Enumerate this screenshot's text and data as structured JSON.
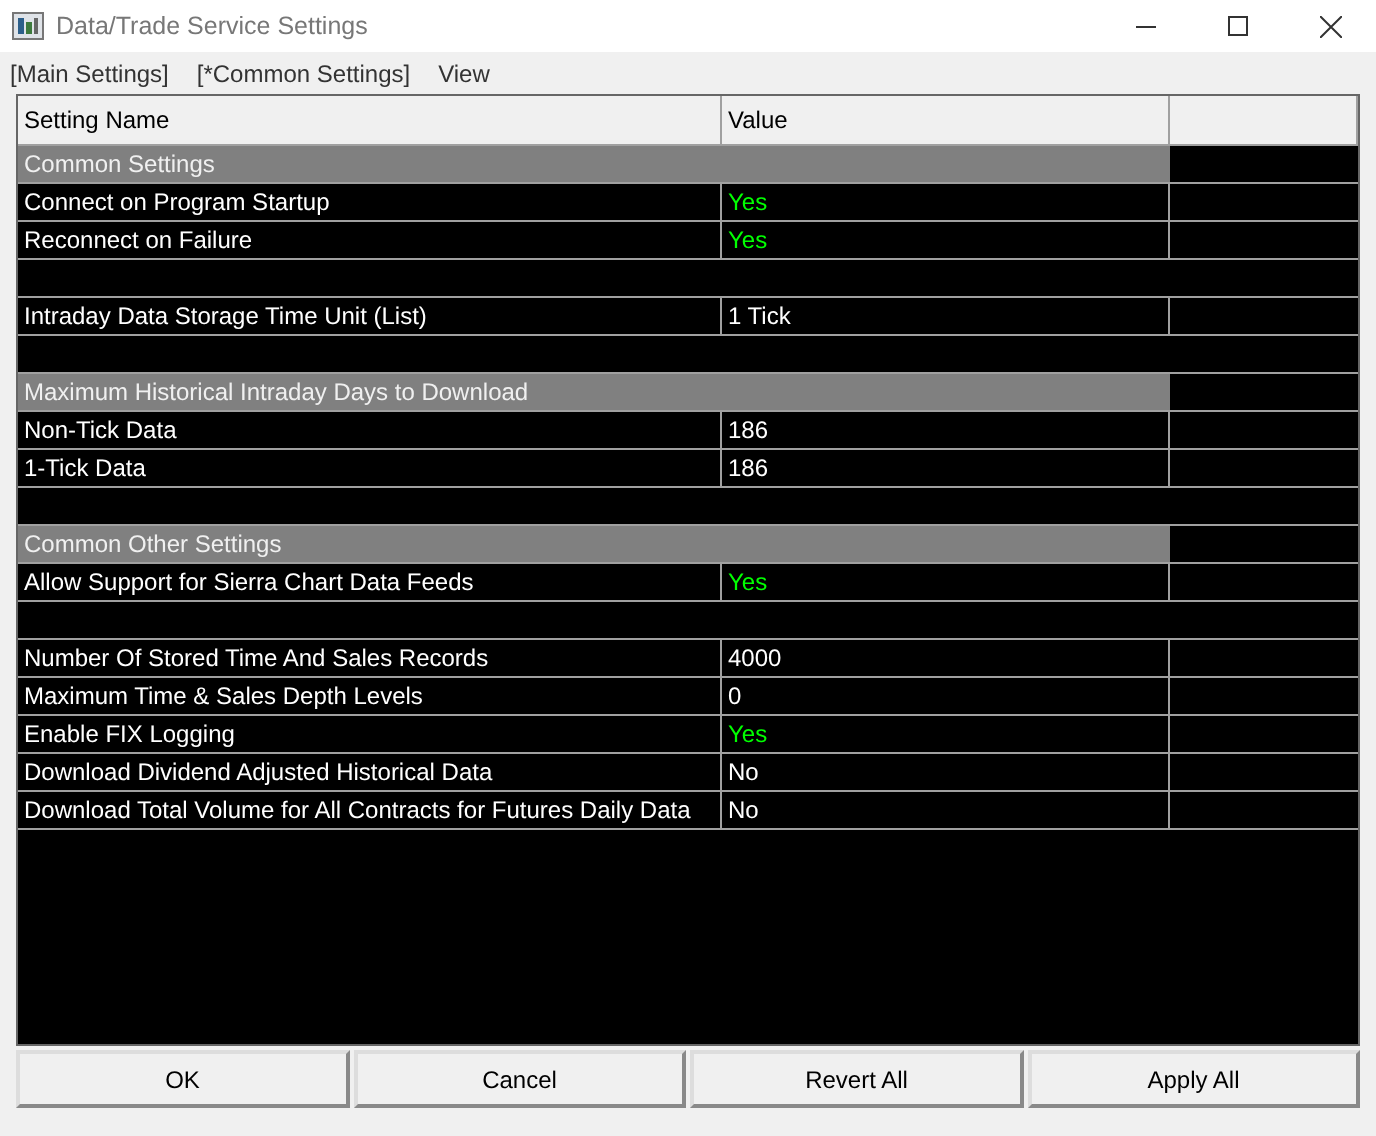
{
  "window": {
    "title": "Data/Trade Service Settings"
  },
  "menu": [
    "[Main Settings]",
    "[*Common Settings]",
    "View"
  ],
  "table": {
    "columns": [
      "Setting Name",
      "Value"
    ],
    "rows": [
      {
        "kind": "section",
        "name": "Common Settings"
      },
      {
        "kind": "setting",
        "name": "Connect on Program Startup",
        "value": "Yes",
        "highlighted": true
      },
      {
        "kind": "setting",
        "name": "Reconnect on Failure",
        "value": "Yes",
        "highlighted": true
      },
      {
        "kind": "blank"
      },
      {
        "kind": "setting",
        "name": "Intraday Data Storage Time Unit (List)",
        "value": "1 Tick",
        "highlighted": false
      },
      {
        "kind": "blank"
      },
      {
        "kind": "section",
        "name": "Maximum Historical Intraday Days to Download"
      },
      {
        "kind": "setting",
        "name": "Non-Tick Data",
        "value": "186",
        "highlighted": false
      },
      {
        "kind": "setting",
        "name": "1-Tick Data",
        "value": "186",
        "highlighted": false
      },
      {
        "kind": "blank"
      },
      {
        "kind": "section",
        "name": "Common Other Settings"
      },
      {
        "kind": "setting",
        "name": "Allow Support for Sierra Chart Data Feeds",
        "value": "Yes",
        "highlighted": true
      },
      {
        "kind": "blank"
      },
      {
        "kind": "setting",
        "name": "Number Of Stored Time And Sales Records",
        "value": "4000",
        "highlighted": false
      },
      {
        "kind": "setting",
        "name": "Maximum Time & Sales Depth Levels",
        "value": "0",
        "highlighted": false
      },
      {
        "kind": "setting",
        "name": "Enable FIX Logging",
        "value": "Yes",
        "highlighted": true
      },
      {
        "kind": "setting",
        "name": "Download Dividend Adjusted Historical Data",
        "value": "No",
        "highlighted": false
      },
      {
        "kind": "setting",
        "name": "Download Total Volume for All Contracts for Futures Daily Data",
        "value": "No",
        "highlighted": false
      }
    ]
  },
  "buttons": [
    "OK",
    "Cancel",
    "Revert All",
    "Apply All"
  ]
}
